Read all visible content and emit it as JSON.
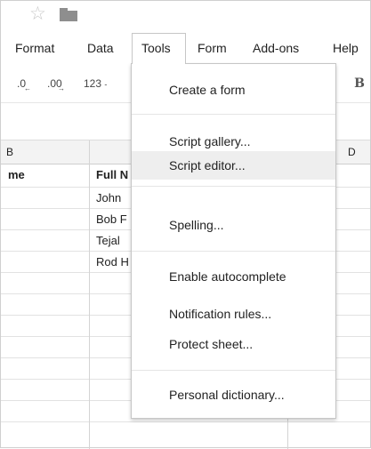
{
  "menubar": {
    "items": [
      "Format",
      "Data",
      "Tools",
      "Form",
      "Add-ons",
      "Help"
    ]
  },
  "toolbar": {
    "decrease_decimal": ".0",
    "increase_decimal": ".00",
    "more_formats": "123",
    "more_formats_caret": "-",
    "bold": "B"
  },
  "grid": {
    "column_headers": [
      "B",
      "D"
    ],
    "header_cells": [
      "me",
      "Full N"
    ],
    "rows": [
      "John",
      "Bob F",
      "Tejal",
      "Rod H"
    ]
  },
  "tools_menu": {
    "items": [
      "Create a form",
      "Script gallery...",
      "Script editor...",
      "Spelling...",
      "Enable autocomplete",
      "Notification rules...",
      "Protect sheet...",
      "Personal dictionary..."
    ]
  },
  "colors": {
    "menu_hover": "#eeeeee",
    "header_bg": "#f3f3f3",
    "icon_gray": "#8e8e8e"
  }
}
